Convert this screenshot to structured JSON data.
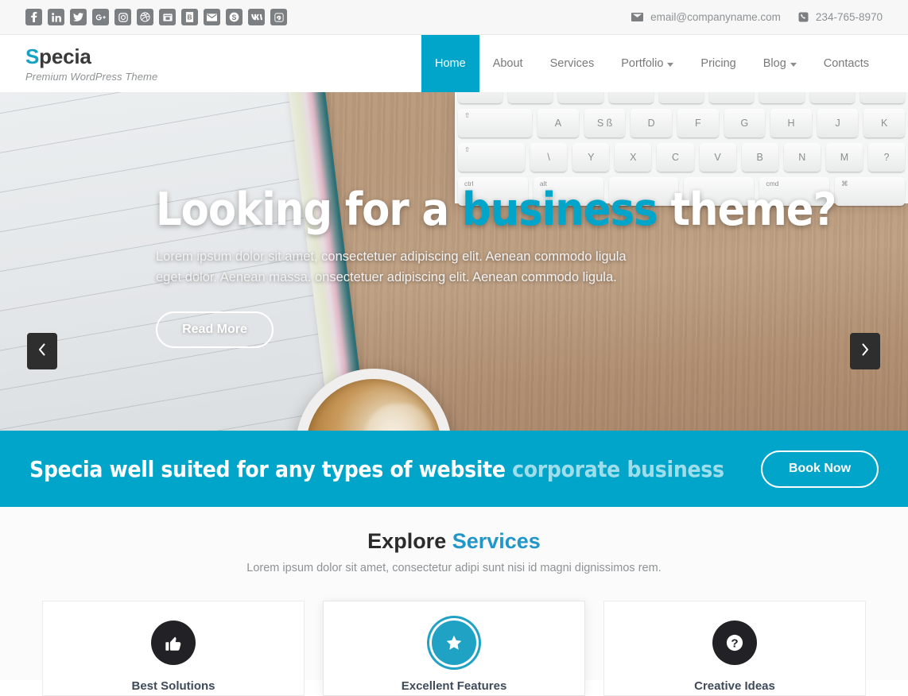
{
  "topbar": {
    "social": [
      {
        "name": "facebook",
        "glyph": "f"
      },
      {
        "name": "linkedin",
        "glyph": "in"
      },
      {
        "name": "twitter",
        "glyph": "t"
      },
      {
        "name": "google-plus",
        "glyph": "G+"
      },
      {
        "name": "instagram",
        "glyph": "ig"
      },
      {
        "name": "dribbble",
        "glyph": "db"
      },
      {
        "name": "flickr",
        "glyph": "fl"
      },
      {
        "name": "behance",
        "glyph": "be"
      },
      {
        "name": "envelope",
        "glyph": "env"
      },
      {
        "name": "skype",
        "glyph": "S"
      },
      {
        "name": "vk",
        "glyph": "vk"
      },
      {
        "name": "pinterest",
        "glyph": "p"
      }
    ],
    "email": "email@companyname.com",
    "phone": "234-765-8970"
  },
  "header": {
    "brand_accent": "S",
    "brand_rest": "pecia",
    "tagline": "Premium WordPress Theme",
    "nav": [
      {
        "label": "Home",
        "active": true,
        "caret": false
      },
      {
        "label": "About",
        "active": false,
        "caret": false
      },
      {
        "label": "Services",
        "active": false,
        "caret": false
      },
      {
        "label": "Portfolio",
        "active": false,
        "caret": true
      },
      {
        "label": "Pricing",
        "active": false,
        "caret": false
      },
      {
        "label": "Blog",
        "active": false,
        "caret": true
      },
      {
        "label": "Contacts",
        "active": false,
        "caret": false
      }
    ]
  },
  "hero": {
    "title_pre": "Looking for a ",
    "title_accent": "business",
    "title_post": " theme?",
    "paragraph": "Lorem ipsum dolor sit amet, consectetuer adipiscing elit. Aenean commodo ligula eget dolor. Aenean massa. onsectetuer adipiscing elit. Aenean commodo ligula.",
    "button": "Read More",
    "prev_icon": "chevron-left",
    "next_icon": "chevron-right",
    "keyboard_row1": [
      "⇧",
      "A",
      "S ß",
      "D",
      "F",
      "G",
      "H",
      "J",
      "K"
    ],
    "keyboard_row2": [
      "⇧",
      "\\",
      "Y",
      "X",
      "C",
      "V",
      "B",
      "N",
      "M",
      "?"
    ],
    "keyboard_row3_labels": [
      "ctrl",
      "alt",
      "cmd",
      "⌘"
    ]
  },
  "cta": {
    "text_strong": "Specia well suited for any types of website ",
    "text_soft": "corporate business",
    "button": "Book Now"
  },
  "services": {
    "title_pre": "Explore ",
    "title_accent": "Services",
    "subtitle": "Lorem ipsum dolor sit amet, consectetur adipi sunt nisi id magni dignissimos rem.",
    "cards": [
      {
        "label": "Best Solutions",
        "icon": "thumbs-up-icon",
        "active": false
      },
      {
        "label": "Excellent Features",
        "icon": "star-icon",
        "active": true
      },
      {
        "label": "Creative Ideas",
        "icon": "question-circle-icon",
        "active": false
      }
    ]
  },
  "colors": {
    "accent": "#00a5c9",
    "accent_soft": "#17a2c4",
    "dark_icon": "#222226",
    "topbar_bg": "#f7f7f7",
    "social_bg": "#7c7f81",
    "text_muted": "#8e9294"
  }
}
